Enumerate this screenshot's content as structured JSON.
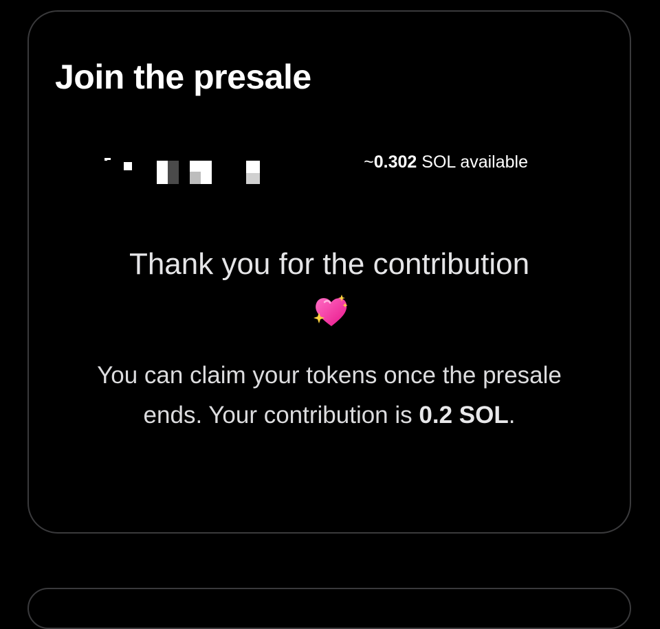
{
  "presale": {
    "title": "Join the presale",
    "balance_prefix": "~",
    "balance_amount": "0.302",
    "balance_suffix": " SOL available"
  },
  "confirmation": {
    "heading": "Thank you for the contribution",
    "heart_emoji_icon": "sparkling-heart-icon",
    "message_part1": "You can claim your tokens once the presale ends. Your contribution is ",
    "contribution_amount": "0.2 SOL",
    "message_end": "."
  },
  "colors": {
    "background": "#000000",
    "card_border": "#3a3a3c",
    "text_primary": "#ffffff",
    "heart": "#ff3ea5"
  }
}
